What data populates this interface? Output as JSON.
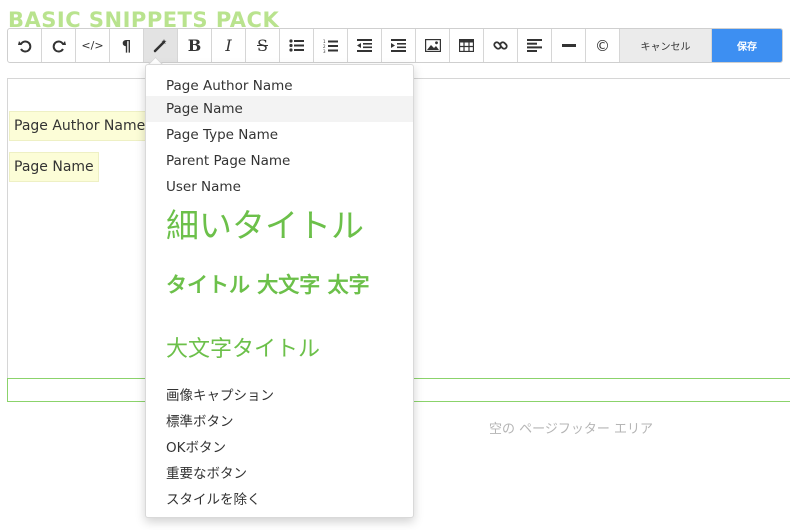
{
  "brand": {
    "title": "BASIC SNIPPETS PACK",
    "color": "#b9e38e"
  },
  "toolbar": {
    "icons": [
      "undo-icon",
      "redo-icon",
      "code-icon",
      "paragraph-icon",
      "magic-wand-icon",
      "bold-icon",
      "italic-icon",
      "strikethrough-icon",
      "bullet-list-icon",
      "numbered-list-icon",
      "outdent-icon",
      "indent-icon",
      "image-icon",
      "table-icon",
      "link-icon",
      "align-icon",
      "horizontal-rule-icon",
      "copyright-icon"
    ],
    "bold_label": "B",
    "italic_label": "I",
    "strike_label": "S",
    "paragraph_label": "¶",
    "code_label": "</>",
    "copyright_label": "©",
    "cancel_label": "キャンセル",
    "save_label": "保存",
    "save_color": "#3d8ff2"
  },
  "editor": {
    "snippets": [
      "Page Author Name",
      "Page Name"
    ]
  },
  "footer": {
    "empty_label": "空の ページフッター エリア"
  },
  "menu": {
    "items": [
      {
        "label": "Page Author Name"
      },
      {
        "label": "Page Name"
      },
      {
        "label": "Page Type Name"
      },
      {
        "label": "Parent Page Name"
      },
      {
        "label": "User Name"
      },
      {
        "label": "細いタイトル"
      },
      {
        "label": "タイトル 大文字 太字"
      },
      {
        "label": "大文字タイトル"
      },
      {
        "label": "画像キャプション"
      },
      {
        "label": "標準ボタン"
      },
      {
        "label": "OKボタン"
      },
      {
        "label": "重要なボタン"
      },
      {
        "label": "スタイルを除く"
      }
    ],
    "accent_color": "#6cc04a"
  }
}
